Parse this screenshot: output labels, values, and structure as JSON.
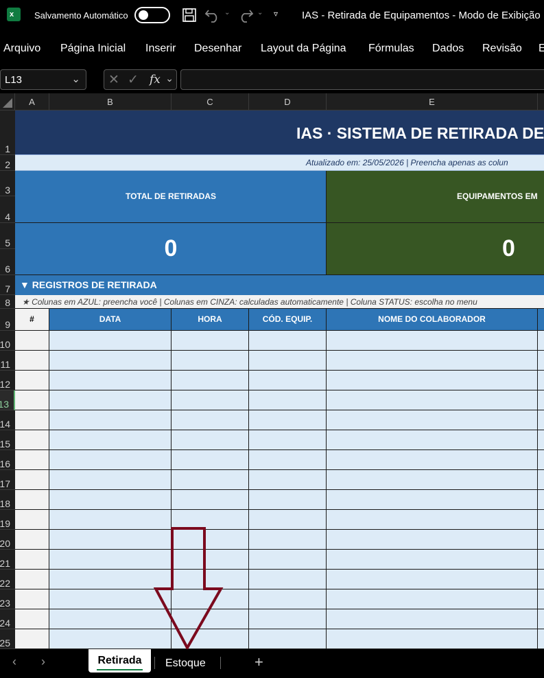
{
  "titlebar": {
    "autosave_label": "Salvamento Automático",
    "window_title": "IAS - Retirada de Equipamentos  -  Modo de Exibição"
  },
  "menu": [
    "Arquivo",
    "Página Inicial",
    "Inserir",
    "Desenhar",
    "Layout da Página",
    "Fórmulas",
    "Dados",
    "Revisão",
    "E"
  ],
  "formula_bar": {
    "name_box": "L13",
    "fx": "fx",
    "formula": ""
  },
  "columns": [
    "A",
    "B",
    "C",
    "D",
    "E"
  ],
  "rows": [
    "1",
    "2",
    "3",
    "4",
    "5",
    "6",
    "7",
    "8",
    "9",
    "10",
    "11",
    "12",
    "13",
    "14",
    "15",
    "16",
    "17",
    "18",
    "19",
    "20",
    "21",
    "22",
    "23",
    "24",
    "25"
  ],
  "sheet": {
    "title": "IAS  ·  SISTEMA DE RETIRADA DE",
    "updated": "Atualizado em: 25/05/2026   |   Preencha apenas as colun",
    "kpi_total_label": "TOTAL DE RETIRADAS",
    "kpi_total_value": "0",
    "kpi_use_label": "EQUIPAMENTOS EM",
    "kpi_use_value": "0",
    "section_title": "▼  REGISTROS DE RETIRADA",
    "note": "★  Colunas em AZUL: preencha você  |  Colunas em CINZA: calculadas automaticamente  |  Coluna STATUS: escolha no menu",
    "headers": [
      "#",
      "DATA",
      "HORA",
      "CÓD. EQUIP.",
      "NOME DO COLABORADOR"
    ]
  },
  "tabs": {
    "active": "Retirada",
    "other": "Estoque",
    "add": "+"
  },
  "colors": {
    "dark_blue": "#1f3864",
    "blue": "#2e75b6",
    "green": "#375623",
    "light_blue": "#ddebf7",
    "arrow": "#7b0a1e"
  }
}
